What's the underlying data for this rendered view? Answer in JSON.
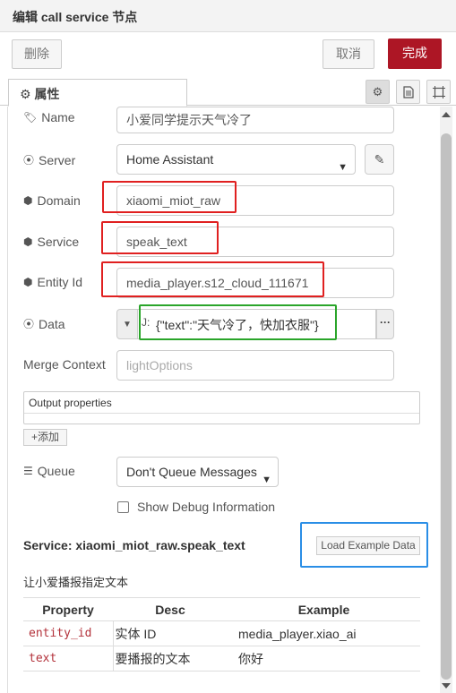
{
  "header": {
    "title": "编辑 call service 节点"
  },
  "toolbar": {
    "delete_label": "删除",
    "cancel_label": "取消",
    "done_label": "完成"
  },
  "tabs": {
    "properties_label": "属性"
  },
  "form": {
    "name": {
      "label": "Name",
      "value": "小爱同学提示天气冷了"
    },
    "server": {
      "label": "Server",
      "value": "Home Assistant"
    },
    "domain": {
      "label": "Domain",
      "value": "xiaomi_miot_raw"
    },
    "service": {
      "label": "Service",
      "value": "speak_text"
    },
    "entity_id": {
      "label": "Entity Id",
      "value": "media_player.s12_cloud_111671"
    },
    "data": {
      "label": "Data",
      "value": "{\"text\":\"天气冷了，快加衣服\"}",
      "type_glyph": "J:"
    },
    "merge_context": {
      "label": "Merge Context",
      "placeholder": "lightOptions"
    },
    "output_properties": {
      "label": "Output properties",
      "add_label": "添加"
    },
    "queue": {
      "label": "Queue",
      "value": "Don't Queue Messages"
    },
    "debug": {
      "label": "Show Debug Information",
      "checked": false
    }
  },
  "service_info": {
    "title": "Service: xiaomi_miot_raw.speak_text",
    "load_example_label": "Load Example Data",
    "description": "让小爱播报指定文本",
    "table": {
      "headers": [
        "Property",
        "Desc",
        "Example"
      ],
      "rows": [
        {
          "property": "entity_id",
          "desc": "实体 ID",
          "example": "media_player.xiao_ai"
        },
        {
          "property": "text",
          "desc": "要播报的文本",
          "example": "你好"
        }
      ]
    }
  },
  "colors": {
    "primary": "#ad1625",
    "highlight_red": "#e02020",
    "highlight_green": "#2aa52a",
    "highlight_blue": "#2a8ee6"
  }
}
